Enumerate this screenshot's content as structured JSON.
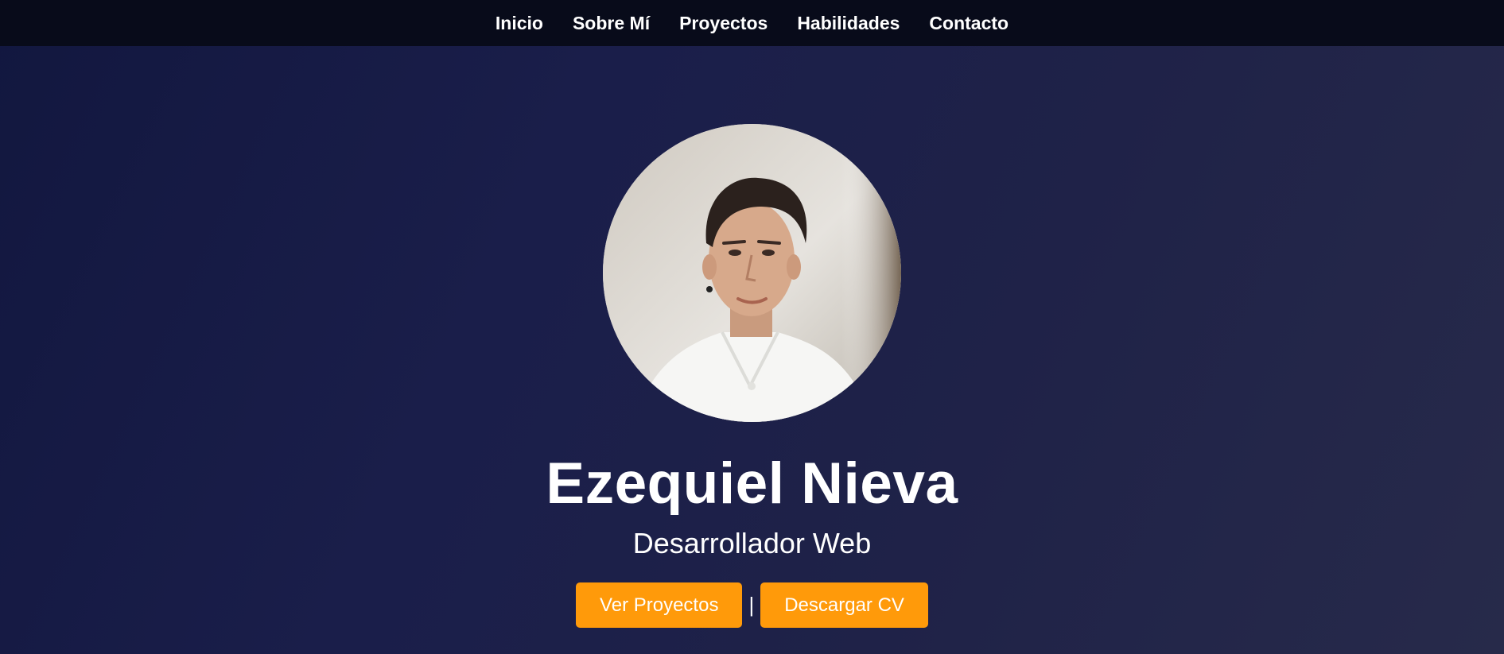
{
  "nav": {
    "items": [
      {
        "label": "Inicio"
      },
      {
        "label": "Sobre Mí"
      },
      {
        "label": "Proyectos"
      },
      {
        "label": "Habilidades"
      },
      {
        "label": "Contacto"
      }
    ]
  },
  "hero": {
    "name": "Ezequiel Nieva",
    "role": "Desarrollador Web",
    "buttons": {
      "projects_label": "Ver Proyectos",
      "separator": "|",
      "cv_label": "Descargar CV"
    }
  },
  "colors": {
    "accent": "#ff9a0a",
    "navbar_bg": "#080b1a",
    "hero_bg_start": "#12173f",
    "hero_bg_end": "#272a4a"
  },
  "icons": {
    "profile_photo": "profile-photo"
  }
}
